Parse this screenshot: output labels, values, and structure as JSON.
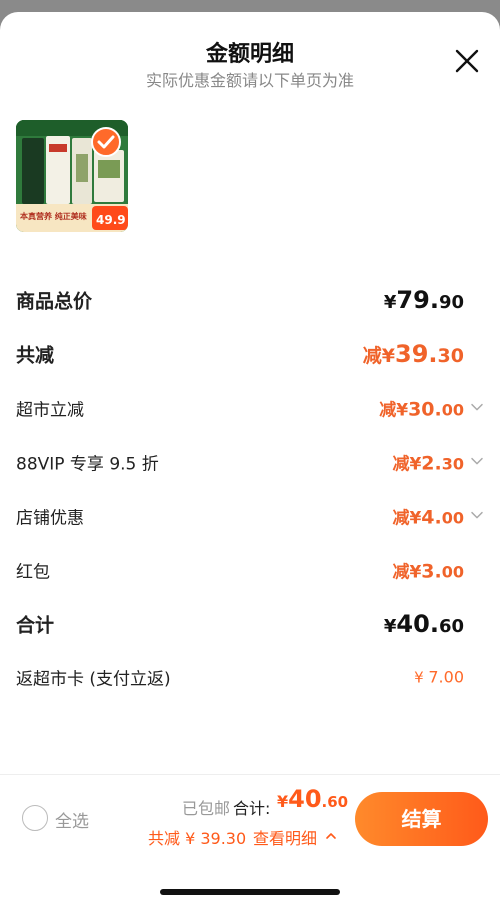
{
  "header": {
    "title": "金额明细",
    "subtitle": "实际优惠金额请以下单页为准"
  },
  "product": {
    "image_text_top": "本真营养 纯正美味",
    "price_tag": "49.9",
    "selected": true
  },
  "rows": [
    {
      "label": "商品总价",
      "prefix": "",
      "currency": "¥",
      "int": "79.",
      "dec": "90",
      "style": "black-big",
      "chevron": false
    },
    {
      "label": "共减",
      "prefix": "减",
      "currency": "¥",
      "int": "39.",
      "dec": "30",
      "style": "orange-big",
      "chevron": false
    },
    {
      "label": "超市立减",
      "prefix": "减",
      "currency": "¥",
      "int": "30.",
      "dec": "00",
      "style": "orange",
      "chevron": true
    },
    {
      "label": "88VIP 专享 9.5 折",
      "prefix": "减",
      "currency": "¥",
      "int": "2.",
      "dec": "30",
      "style": "orange",
      "chevron": true
    },
    {
      "label": "店铺优惠",
      "prefix": "减",
      "currency": "¥",
      "int": "4.",
      "dec": "00",
      "style": "orange",
      "chevron": true
    },
    {
      "label": "红包",
      "prefix": "减",
      "currency": "¥",
      "int": "3.",
      "dec": "00",
      "style": "orange",
      "chevron": false
    },
    {
      "label": "合计",
      "prefix": "",
      "currency": "¥",
      "int": "40.",
      "dec": "60",
      "style": "black-big",
      "chevron": false
    },
    {
      "label": "返超市卡 (支付立返)",
      "prefix": "",
      "currency": "¥",
      "int": "7.",
      "dec": "00",
      "style": "orange-light",
      "chevron": false
    }
  ],
  "footer": {
    "select_all": "全选",
    "shipped": "已包邮",
    "total_label": "合计:",
    "total_currency": "¥",
    "total_int": "40",
    "total_dec": ".60",
    "reduce_text": "共减 ¥ 39.30",
    "detail_text": "查看明细",
    "checkout": "结算"
  },
  "colors": {
    "accent": "#ff5a1a",
    "discount": "#f0632a"
  },
  "icons": {
    "close": "close-icon",
    "chevron": "chevron-down-icon",
    "check": "check-icon",
    "up": "chevron-up-icon"
  }
}
